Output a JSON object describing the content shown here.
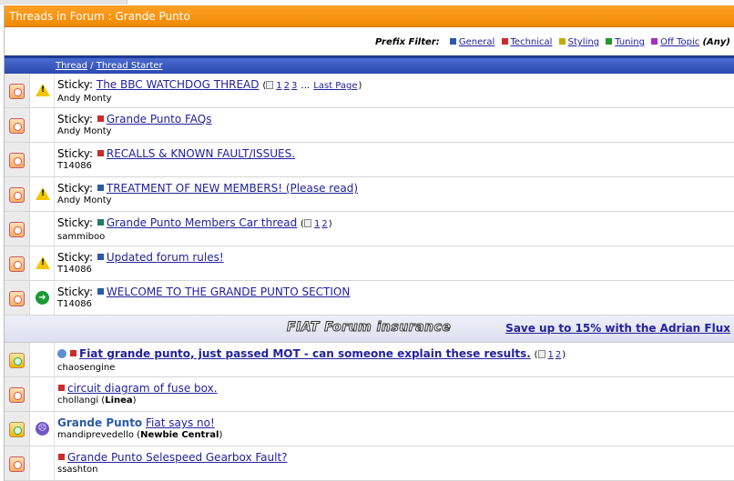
{
  "forum_title": "Threads in Forum : Grande Punto",
  "prefix_filter": {
    "label": "Prefix Filter:",
    "options": [
      {
        "label": "General",
        "color": "#2b5aa6"
      },
      {
        "label": "Technical",
        "color": "#cc2b2b"
      },
      {
        "label": "Styling",
        "color": "#c9a800"
      },
      {
        "label": "Tuning",
        "color": "#1f9a2a"
      },
      {
        "label": "Off Topic",
        "color": "#a42fbf"
      }
    ],
    "any": "Any"
  },
  "columns": {
    "thread": "Thread",
    "separator": "/",
    "starter": "Thread Starter"
  },
  "sticky_label": "Sticky:",
  "threads": [
    {
      "title": "The BBC WATCHDOG THREAD",
      "starter": "Andy Monty",
      "prefix_color": "",
      "pages": [
        "1",
        "2",
        "3"
      ],
      "ellipsis": "...",
      "last_page": "Last Page",
      "icon": "warning-icon"
    },
    {
      "title": "Grande Punto FAQs",
      "starter": "Andy Monty",
      "prefix_color": "#cc2b2b",
      "icon": "none"
    },
    {
      "title": "RECALLS & KNOWN FAULT/ISSUES.",
      "starter": "T14086",
      "prefix_color": "#cc2b2b",
      "icon": "none"
    },
    {
      "title": "TREATMENT OF NEW MEMBERS! (Please read)",
      "starter": "Andy Monty",
      "prefix_color": "#2b5aa6",
      "icon": "warning-icon"
    },
    {
      "title": "Grande Punto Members Car thread",
      "starter": "sammiboo",
      "prefix_color": "#1f7a6a",
      "pages": [
        "1",
        "2"
      ],
      "icon": "none"
    },
    {
      "title": "Updated forum rules!",
      "starter": "T14086",
      "prefix_color": "#2b5aa6",
      "icon": "warning-icon"
    },
    {
      "title": "WELCOME TO THE GRANDE PUNTO SECTION",
      "starter": "T14086",
      "prefix_color": "#2b5aa6",
      "icon": "arrow-right-icon"
    }
  ],
  "ad": {
    "logo_text": "FIAT Forum insurance",
    "link_text": "Save up to 15% with the Adrian Flux"
  },
  "normal_threads": [
    {
      "title": "Fiat grande punto, just passed MOT - can someone explain these results.",
      "starter": "chaosengine",
      "pages": [
        "1",
        "2"
      ]
    },
    {
      "title": "circuit diagram of fuse box.",
      "starter": "chollangi",
      "group": "Linea"
    },
    {
      "prefix_text": "Grande Punto",
      "title": "Fiat says no!",
      "starter": "mandiprevedello",
      "group": "Newbie Central"
    },
    {
      "title": "Grande Punto Selespeed Gearbox Fault?",
      "starter": "ssashton"
    }
  ]
}
